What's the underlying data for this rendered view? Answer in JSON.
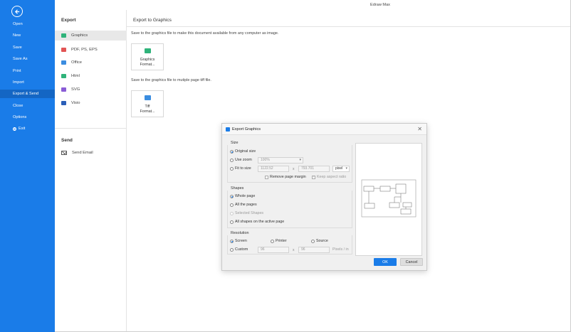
{
  "app": {
    "title": "Edraw Max"
  },
  "sidebar": {
    "items": [
      "Open",
      "New",
      "Save",
      "Save As",
      "Print",
      "Import",
      "Export & Send",
      "Close",
      "Options",
      "Exit"
    ],
    "active": "Export & Send"
  },
  "middle": {
    "export_heading": "Export",
    "export_items": [
      {
        "label": "Graphics",
        "icon": "graphics-icon",
        "color": "#2fb37a"
      },
      {
        "label": "PDF, PS, EPS",
        "icon": "pdf-icon",
        "color": "#e25454"
      },
      {
        "label": "Office",
        "icon": "office-icon",
        "color": "#3b8de0"
      },
      {
        "label": "Html",
        "icon": "html-icon",
        "color": "#2fb37a"
      },
      {
        "label": "SVG",
        "icon": "svg-icon",
        "color": "#8a5cd6"
      },
      {
        "label": "Visio",
        "icon": "visio-icon",
        "color": "#2b5fb8"
      }
    ],
    "send_heading": "Send",
    "send_items": [
      {
        "label": "Send Email",
        "icon": "mail-icon"
      }
    ]
  },
  "main": {
    "title": "Export to Graphics",
    "desc_graphics": "Save to the graphics file to make this document available from any computer as image.",
    "card_graphics": "Graphics\nFormat...",
    "desc_tiff": "Save to the graphics file to mutiple page tiff file.",
    "card_tiff": "Tiff\nFormat..."
  },
  "dialog": {
    "title": "Export Graphics",
    "close": "✕",
    "size": {
      "label": "Size",
      "original": "Original size",
      "use_zoom": "Use zoom",
      "zoom_value": "100%",
      "fit_to_size": "Fit to size",
      "width": "1122.52",
      "times": "x",
      "height": "793.701",
      "unit": "pixel",
      "remove_margin": "Remove page margin",
      "keep_aspect": "Keep aspect ratio"
    },
    "shapes": {
      "label": "Shapes",
      "whole_page": "Whole page",
      "all_pages": "All the pages",
      "selected_shapes": "Selected Shapes",
      "all_active": "All shapes on the active page"
    },
    "resolution": {
      "label": "Resolution",
      "screen": "Screen",
      "printer": "Printer",
      "source": "Source",
      "custom": "Custom",
      "x_value": "96",
      "times": "x",
      "y_value": "96",
      "unit": "Pixels / in"
    },
    "ok": "OK",
    "cancel": "Cancel"
  }
}
